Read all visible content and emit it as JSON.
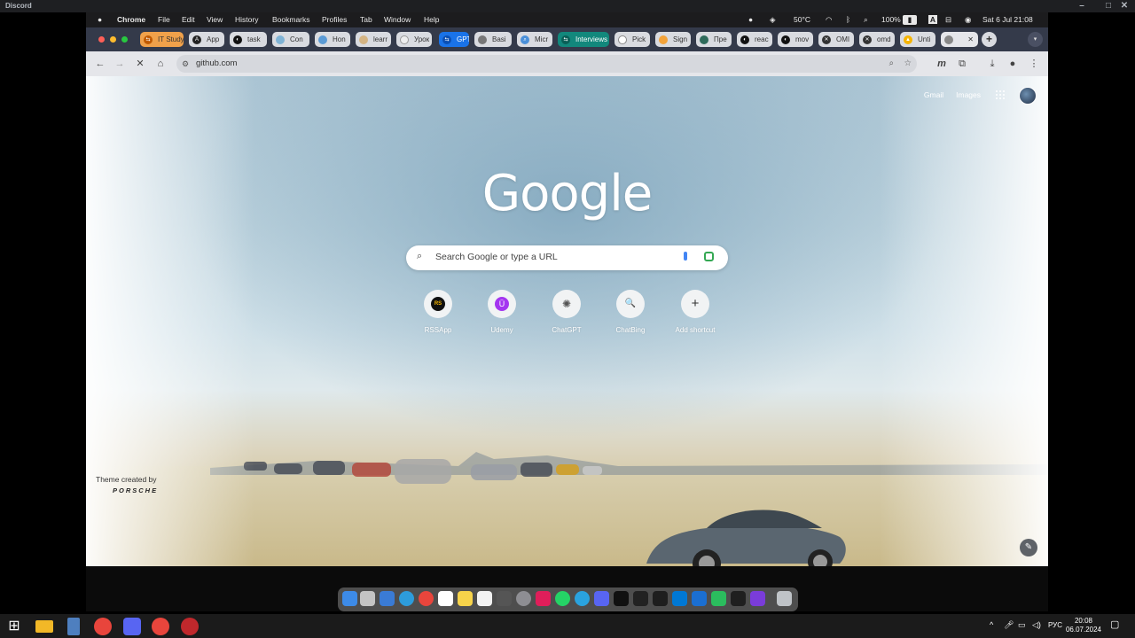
{
  "discord": {
    "title": "Discord"
  },
  "menubar": {
    "app": "Chrome",
    "items": [
      "File",
      "Edit",
      "View",
      "History",
      "Bookmarks",
      "Profiles",
      "Tab",
      "Window",
      "Help"
    ],
    "temperature": "50°C",
    "battery": "100%",
    "input_source": "A",
    "datetime": "Sat 6 Jul  21:08"
  },
  "tabs": [
    {
      "label": "IT Study"
    },
    {
      "label": "App"
    },
    {
      "label": "task"
    },
    {
      "label": "Con"
    },
    {
      "label": "Hon"
    },
    {
      "label": "learr"
    },
    {
      "label": "Урок"
    },
    {
      "label": "GPT"
    },
    {
      "label": "Basi"
    },
    {
      "label": "Micr"
    },
    {
      "label": "Interviews"
    },
    {
      "label": "Pick"
    },
    {
      "label": "Sign"
    },
    {
      "label": "Пре"
    },
    {
      "label": "reac"
    },
    {
      "label": "mov"
    },
    {
      "label": "OMI"
    },
    {
      "label": "omd"
    },
    {
      "label": "Unti"
    },
    {
      "label": ""
    }
  ],
  "omnibox": {
    "url": "github.com"
  },
  "ntp": {
    "logo": "Google",
    "top_links": [
      "Gmail",
      "Images"
    ],
    "search_placeholder": "Search Google or type a URL",
    "shortcuts": [
      {
        "label": "RSSApp",
        "icon": "rssapp-icon",
        "glyph": "RS"
      },
      {
        "label": "Udemy",
        "icon": "udemy-icon",
        "glyph": "Ü"
      },
      {
        "label": "ChatGPT",
        "icon": "chatgpt-icon",
        "glyph": "✺"
      },
      {
        "label": "ChatBing",
        "icon": "search-icon",
        "glyph": "🔍"
      },
      {
        "label": "Add shortcut",
        "icon": "plus-icon",
        "glyph": "+"
      }
    ],
    "theme_credit": "Theme created by",
    "theme_brand": "PORSCHE"
  },
  "taskbar": {
    "lang": "РУС",
    "time": "20:08",
    "date": "06.07.2024"
  }
}
